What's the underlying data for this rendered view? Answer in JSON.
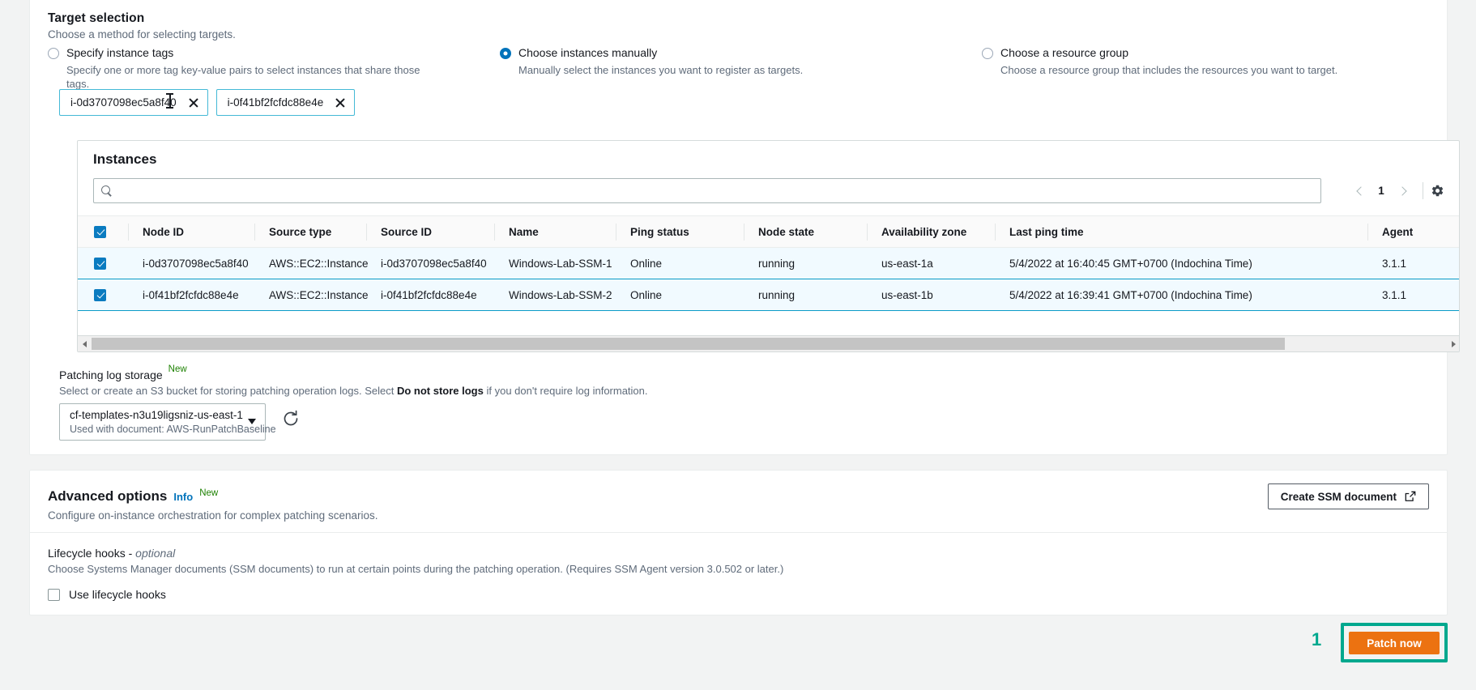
{
  "target_selection": {
    "title": "Target selection",
    "description": "Choose a method for selecting targets.",
    "options": [
      {
        "label": "Specify instance tags",
        "sub": "Specify one or more tag key-value pairs to select instances that share those tags.",
        "selected": false
      },
      {
        "label": "Choose instances manually",
        "sub": "Manually select the instances you want to register as targets.",
        "selected": true
      },
      {
        "label": "Choose a resource group",
        "sub": "Choose a resource group that includes the resources you want to target.",
        "selected": false
      }
    ],
    "tokens": [
      {
        "label": "i-0d3707098ec5a8f40"
      },
      {
        "label": "i-0f41bf2fcfdc88e4e"
      }
    ]
  },
  "instances_table": {
    "title": "Instances",
    "search_placeholder": "",
    "search_value": "",
    "page_number": "1",
    "columns": [
      "Node ID",
      "Source type",
      "Source ID",
      "Name",
      "Ping status",
      "Node state",
      "Availability zone",
      "Last ping time",
      "Agent"
    ],
    "header_select_all_checked": true,
    "rows": [
      {
        "checked": true,
        "node_id": "i-0d3707098ec5a8f40",
        "source_type": "AWS::EC2::Instance",
        "source_id": "i-0d3707098ec5a8f40",
        "name": "Windows-Lab-SSM-1",
        "ping_status": "Online",
        "node_state": "running",
        "availability_zone": "us-east-1a",
        "last_ping_time": "5/4/2022 at 16:40:45 GMT+0700 (Indochina Time)",
        "agent": "3.1.1"
      },
      {
        "checked": true,
        "node_id": "i-0f41bf2fcfdc88e4e",
        "source_type": "AWS::EC2::Instance",
        "source_id": "i-0f41bf2fcfdc88e4e",
        "name": "Windows-Lab-SSM-2",
        "ping_status": "Online",
        "node_state": "running",
        "availability_zone": "us-east-1b",
        "last_ping_time": "5/4/2022 at 16:39:41 GMT+0700 (Indochina Time)",
        "agent": "3.1.1"
      }
    ]
  },
  "patching_log_storage": {
    "title": "Patching log storage",
    "badge": "New",
    "description_pre": "Select or create an S3 bucket for storing patching operation logs. Select ",
    "description_bold": "Do not store logs",
    "description_post": " if you don't require log information.",
    "selected_bucket": "cf-templates-n3u19ligsniz-us-east-1",
    "selected_sub": "Used with document: AWS-RunPatchBaseline"
  },
  "advanced_options": {
    "title": "Advanced options",
    "info_label": "Info",
    "badge": "New",
    "description": "Configure on-instance orchestration for complex patching scenarios.",
    "create_ssm_label": "Create SSM document",
    "lifecycle": {
      "title_main": "Lifecycle hooks - ",
      "title_opt": "optional",
      "description": "Choose Systems Manager documents (SSM documents) to run at certain points during the patching operation. (Requires SSM Agent version 3.0.502 or later.)",
      "checkbox_label": "Use lifecycle hooks",
      "checkbox_checked": false
    }
  },
  "footer": {
    "annotation_number": "1",
    "patch_now_label": "Patch now"
  },
  "colors": {
    "accent_orange": "#ec7211",
    "annotation_teal": "#00a88e",
    "link_blue": "#0073bb",
    "new_green": "#1d8102",
    "row_selected_bg": "#f1faff",
    "row_selected_border": "#0a9bc7"
  }
}
